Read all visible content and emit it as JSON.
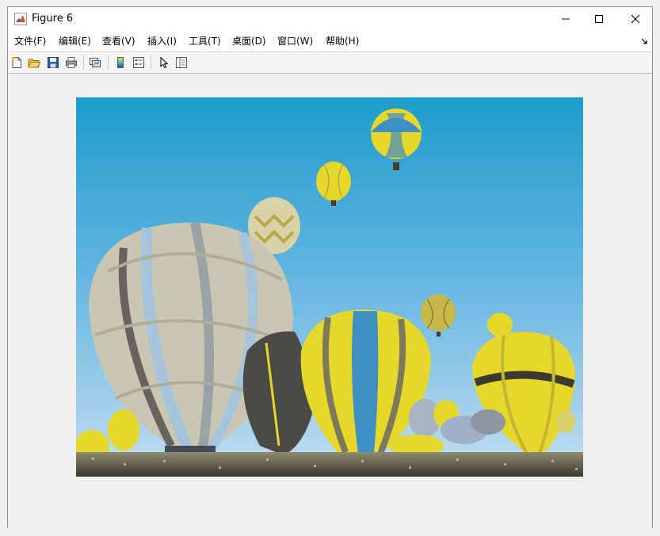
{
  "window": {
    "title": "Figure 6",
    "icon": "matlab-icon",
    "controls": [
      "minimize-icon",
      "maximize-icon",
      "close-icon"
    ]
  },
  "menu": {
    "items": [
      {
        "label": "文件(F)"
      },
      {
        "label": "编辑(E)"
      },
      {
        "label": "查看(V)"
      },
      {
        "label": "插入(I)"
      },
      {
        "label": "工具(T)"
      },
      {
        "label": "桌面(D)"
      },
      {
        "label": "窗口(W)"
      },
      {
        "label": "帮助(H)"
      }
    ],
    "undock_icon": "undock-arrow-icon"
  },
  "toolbar": {
    "buttons": [
      {
        "icon": "new-figure-icon"
      },
      {
        "icon": "open-file-icon"
      },
      {
        "icon": "save-icon"
      },
      {
        "icon": "print-icon"
      },
      {
        "icon": "link-plot-icon"
      },
      {
        "icon": "colorbar-icon"
      },
      {
        "icon": "legend-icon"
      },
      {
        "icon": "edit-plot-pointer-icon"
      },
      {
        "icon": "property-inspector-icon"
      }
    ]
  },
  "figure": {
    "content": "photo-hot-air-balloons",
    "colors": {
      "sky_top": "#1e9ccc",
      "sky_bottom": "#b0d6ee",
      "balloon_yellow": "#e6d82a",
      "balloon_gray": "#c9c6b2",
      "balloon_blue": "#3e8fc4"
    }
  }
}
